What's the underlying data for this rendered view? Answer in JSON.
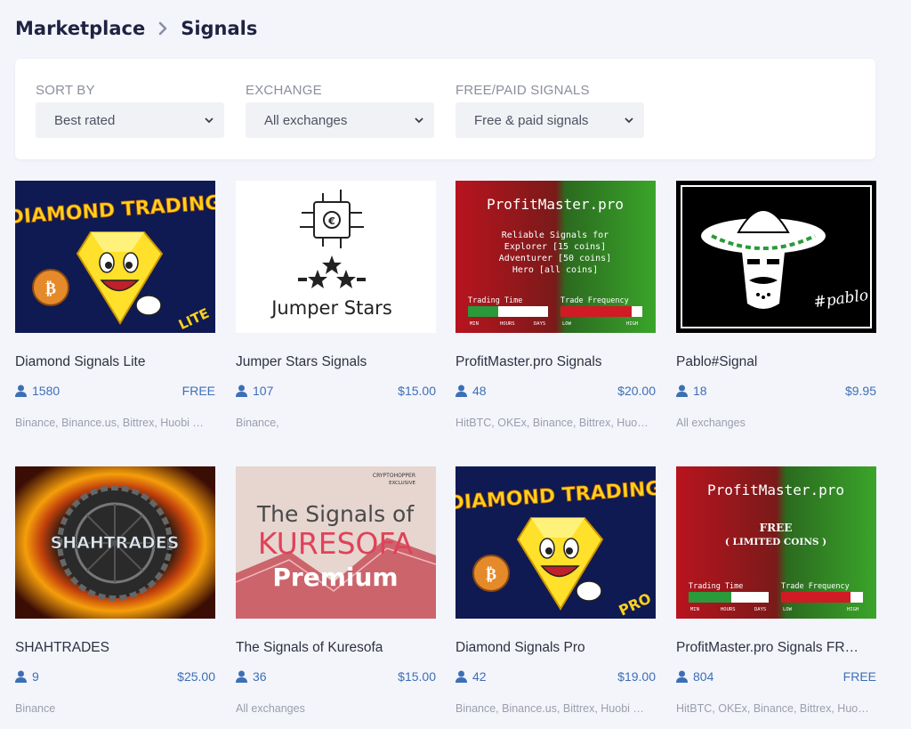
{
  "breadcrumb": {
    "root": "Marketplace",
    "current": "Signals"
  },
  "filters": {
    "sort": {
      "label": "SORT BY",
      "value": "Best rated"
    },
    "exchange": {
      "label": "EXCHANGE",
      "value": "All exchanges"
    },
    "type": {
      "label": "FREE/PAID SIGNALS",
      "value": "Free & paid signals"
    }
  },
  "thumbs": {
    "diamond": {
      "title": "DIAMOND TRADING",
      "badge_lite": "LITE",
      "badge_pro": "PRO"
    },
    "jumper": {
      "text": "Jumper Stars"
    },
    "profit": {
      "header": "ProfitMaster.pro",
      "lines": [
        "Reliable Signals for",
        "Explorer [15 coins]",
        "Adventurer [50 coins]",
        "Hero [all coins]"
      ],
      "free_line1": "FREE",
      "free_line2": "( LIMITED COINS )",
      "trading_time": "Trading Time",
      "trade_freq": "Trade Frequency",
      "scale_left": [
        "MIN",
        "HOURS",
        "DAYS"
      ],
      "scale_right": [
        "LOW",
        "HIGH"
      ]
    },
    "pablo": {
      "tag": "#pablo"
    },
    "shah": {
      "text": "SHAHTRADES"
    },
    "kuresofa": {
      "badge1": "CRYPTOHOPPER",
      "badge2": "EXCLUSIVE",
      "line1": "The Signals of",
      "line2": "KURESOFA",
      "line3": "Premium"
    }
  },
  "cards": [
    {
      "title": "Diamond Signals Lite",
      "subscribers": "1580",
      "price": "FREE",
      "exchanges": "Binance, Binance.us, Bittrex, Huobi …"
    },
    {
      "title": "Jumper Stars Signals",
      "subscribers": "107",
      "price": "$15.00",
      "exchanges": "Binance,"
    },
    {
      "title": "ProfitMaster.pro Signals",
      "subscribers": "48",
      "price": "$20.00",
      "exchanges": "HitBTC, OKEx, Binance, Bittrex, Huo…"
    },
    {
      "title": "Pablo#Signal",
      "subscribers": "18",
      "price": "$9.95",
      "exchanges": "All exchanges"
    },
    {
      "title": "SHAHTRADES",
      "subscribers": "9",
      "price": "$25.00",
      "exchanges": "Binance"
    },
    {
      "title": "The Signals of Kuresofa",
      "subscribers": "36",
      "price": "$15.00",
      "exchanges": "All exchanges"
    },
    {
      "title": "Diamond Signals Pro",
      "subscribers": "42",
      "price": "$19.00",
      "exchanges": "Binance, Binance.us, Bittrex, Huobi …"
    },
    {
      "title": "ProfitMaster.pro Signals FR…",
      "subscribers": "804",
      "price": "FREE",
      "exchanges": "HitBTC, OKEx, Binance, Bittrex, Huo…"
    }
  ],
  "icons": {
    "subscribers": "user-icon",
    "dropdown": "chevron-down-icon"
  },
  "colors": {
    "link": "#3c6fb5",
    "title": "#1f2342",
    "background": "#f4f5fb"
  }
}
